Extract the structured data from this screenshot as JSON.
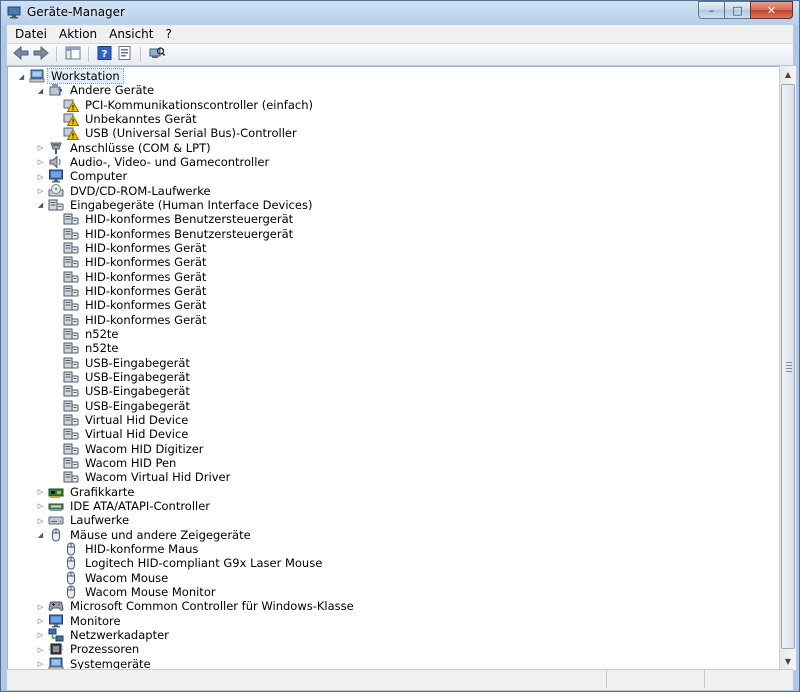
{
  "window": {
    "title": "Geräte-Manager",
    "app_icon": "device-manager-icon"
  },
  "window_buttons": {
    "minimize": "–",
    "maximize": "□",
    "close": "✕"
  },
  "menu": [
    {
      "label": "Datei",
      "name": "menu-datei"
    },
    {
      "label": "Aktion",
      "name": "menu-aktion"
    },
    {
      "label": "Ansicht",
      "name": "menu-ansicht"
    },
    {
      "label": "?",
      "name": "menu-help"
    }
  ],
  "toolbar": [
    {
      "icon": "back-arrow-icon"
    },
    {
      "icon": "forward-arrow-icon"
    },
    {
      "sep": true
    },
    {
      "icon": "show-hide-console-tree-icon"
    },
    {
      "sep": true
    },
    {
      "icon": "help-icon"
    },
    {
      "icon": "properties-icon"
    },
    {
      "sep": true
    },
    {
      "icon": "scan-hardware-icon"
    }
  ],
  "tree": [
    {
      "label": "Workstation",
      "level": 0,
      "icon": "computer-icon",
      "expander": "open",
      "root": true
    },
    {
      "label": "Andere Geräte",
      "level": 1,
      "icon": "unknown-device-category-icon",
      "expander": "open"
    },
    {
      "label": "PCI-Kommunikationscontroller (einfach)",
      "level": 2,
      "icon": "warning-device-icon"
    },
    {
      "label": "Unbekanntes Gerät",
      "level": 2,
      "icon": "warning-device-icon"
    },
    {
      "label": "USB (Universal Serial Bus)-Controller",
      "level": 2,
      "icon": "warning-device-icon"
    },
    {
      "label": "Anschlüsse (COM & LPT)",
      "level": 1,
      "icon": "port-icon",
      "expander": "closed"
    },
    {
      "label": "Audio-, Video- und Gamecontroller",
      "level": 1,
      "icon": "speaker-icon",
      "expander": "closed"
    },
    {
      "label": "Computer",
      "level": 1,
      "icon": "monitor-icon",
      "expander": "closed"
    },
    {
      "label": "DVD/CD-ROM-Laufwerke",
      "level": 1,
      "icon": "disc-drive-icon",
      "expander": "closed"
    },
    {
      "label": "Eingabegeräte (Human Interface Devices)",
      "level": 1,
      "icon": "hid-icon",
      "expander": "open"
    },
    {
      "label": "HID-konformes Benutzersteuergerät",
      "level": 2,
      "icon": "hid-icon"
    },
    {
      "label": "HID-konformes Benutzersteuergerät",
      "level": 2,
      "icon": "hid-icon"
    },
    {
      "label": "HID-konformes Gerät",
      "level": 2,
      "icon": "hid-icon"
    },
    {
      "label": "HID-konformes Gerät",
      "level": 2,
      "icon": "hid-icon"
    },
    {
      "label": "HID-konformes Gerät",
      "level": 2,
      "icon": "hid-icon"
    },
    {
      "label": "HID-konformes Gerät",
      "level": 2,
      "icon": "hid-icon"
    },
    {
      "label": "HID-konformes Gerät",
      "level": 2,
      "icon": "hid-icon"
    },
    {
      "label": "HID-konformes Gerät",
      "level": 2,
      "icon": "hid-icon"
    },
    {
      "label": "n52te",
      "level": 2,
      "icon": "hid-icon"
    },
    {
      "label": "n52te",
      "level": 2,
      "icon": "hid-icon"
    },
    {
      "label": "USB-Eingabegerät",
      "level": 2,
      "icon": "hid-icon"
    },
    {
      "label": "USB-Eingabegerät",
      "level": 2,
      "icon": "hid-icon"
    },
    {
      "label": "USB-Eingabegerät",
      "level": 2,
      "icon": "hid-icon"
    },
    {
      "label": "USB-Eingabegerät",
      "level": 2,
      "icon": "hid-icon"
    },
    {
      "label": "Virtual Hid Device",
      "level": 2,
      "icon": "hid-icon"
    },
    {
      "label": "Virtual Hid Device",
      "level": 2,
      "icon": "hid-icon"
    },
    {
      "label": "Wacom HID Digitizer",
      "level": 2,
      "icon": "hid-icon"
    },
    {
      "label": "Wacom HID Pen",
      "level": 2,
      "icon": "hid-icon"
    },
    {
      "label": "Wacom Virtual Hid Driver",
      "level": 2,
      "icon": "hid-icon"
    },
    {
      "label": "Grafikkarte",
      "level": 1,
      "icon": "display-adapter-icon",
      "expander": "closed"
    },
    {
      "label": "IDE ATA/ATAPI-Controller",
      "level": 1,
      "icon": "ide-controller-icon",
      "expander": "closed"
    },
    {
      "label": "Laufwerke",
      "level": 1,
      "icon": "disk-drive-icon",
      "expander": "closed"
    },
    {
      "label": "Mäuse und andere Zeigegeräte",
      "level": 1,
      "icon": "mouse-icon",
      "expander": "open"
    },
    {
      "label": "HID-konforme Maus",
      "level": 2,
      "icon": "mouse-icon"
    },
    {
      "label": "Logitech HID-compliant G9x Laser Mouse",
      "level": 2,
      "icon": "mouse-icon"
    },
    {
      "label": "Wacom Mouse",
      "level": 2,
      "icon": "mouse-icon"
    },
    {
      "label": "Wacom Mouse Monitor",
      "level": 2,
      "icon": "mouse-icon"
    },
    {
      "label": "Microsoft Common Controller für Windows-Klasse",
      "level": 1,
      "icon": "gamepad-icon",
      "expander": "closed"
    },
    {
      "label": "Monitore",
      "level": 1,
      "icon": "monitor-icon",
      "expander": "closed"
    },
    {
      "label": "Netzwerkadapter",
      "level": 1,
      "icon": "network-adapter-icon",
      "expander": "closed"
    },
    {
      "label": "Prozessoren",
      "level": 1,
      "icon": "processor-icon",
      "expander": "closed"
    },
    {
      "label": "Systemgeräte",
      "level": 1,
      "icon": "system-device-icon",
      "expander": "closed"
    }
  ],
  "colors": {
    "selection": "#e2ecf8",
    "warning": "#f2c200",
    "title_bg": "#bcd3ea"
  }
}
